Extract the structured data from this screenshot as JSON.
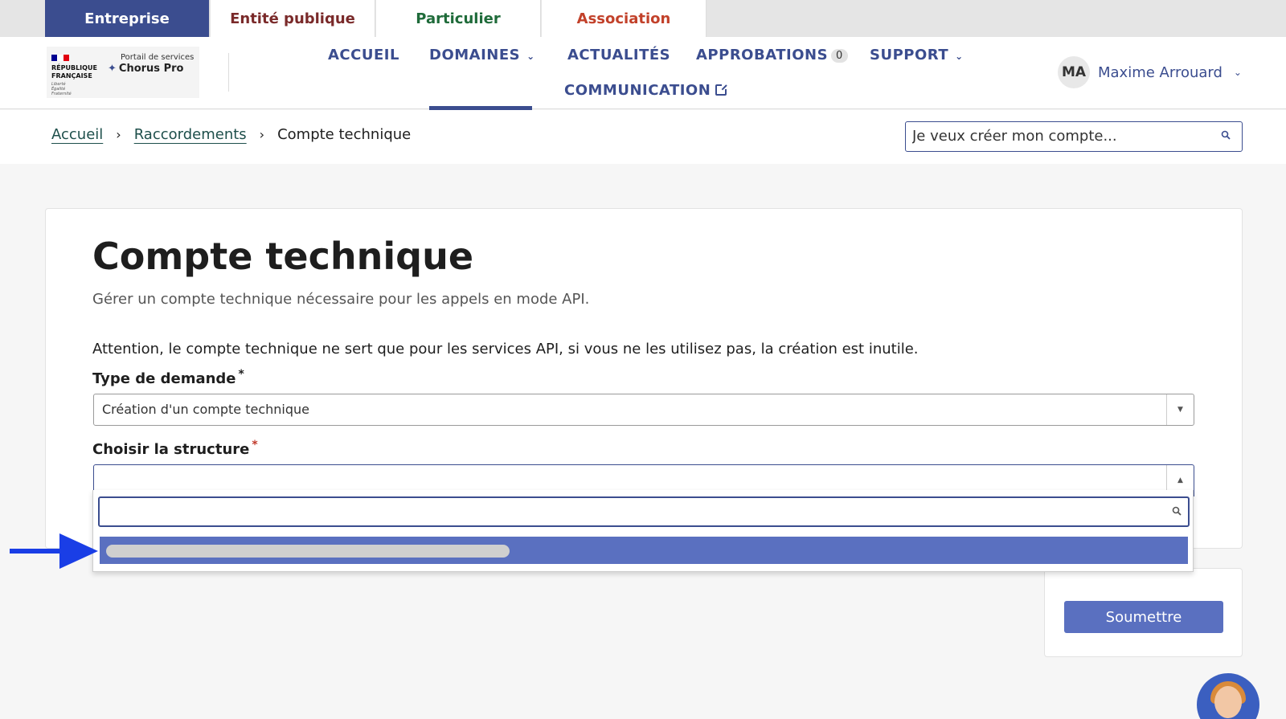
{
  "audience_tabs": [
    {
      "label": "Entreprise",
      "color": "#ffffff",
      "active": true
    },
    {
      "label": "Entité publique",
      "color": "#7a2a2a",
      "active": false
    },
    {
      "label": "Particulier",
      "color": "#1f6b3a",
      "active": false
    },
    {
      "label": "Association",
      "color": "#c2412a",
      "active": false
    }
  ],
  "logo": {
    "republique": "RÉPUBLIQUE FRANÇAISE",
    "devise": "Liberté Égalité Fraternité",
    "portail": "Portail de services",
    "product": "Chorus Pro"
  },
  "nav": {
    "accueil": "ACCUEIL",
    "domaines": "DOMAINES",
    "actualites": "ACTUALITÉS",
    "approbations": "APPROBATIONS",
    "approbations_count": "0",
    "support": "SUPPORT",
    "communication": "COMMUNICATION"
  },
  "user": {
    "initials": "MA",
    "name": "Maxime Arrouard"
  },
  "breadcrumb": {
    "home": "Accueil",
    "parent": "Raccordements",
    "current": "Compte technique",
    "separator": "›"
  },
  "search": {
    "placeholder": "Je veux créer mon compte..."
  },
  "form": {
    "title": "Compte technique",
    "subtitle": "Gérer un compte technique nécessaire pour les appels en mode API.",
    "warning": "Attention, le compte technique ne sert que pour les services API, si vous ne les utilisez pas, la création est inutile.",
    "type_label": "Type de demande",
    "type_value": "Création d'un compte technique",
    "structure_label": "Choisir la structure",
    "structure_value": "",
    "required_mark": "*"
  },
  "submit": {
    "label": "Soumettre"
  },
  "colors": {
    "primary": "#3b4d8f",
    "accent": "#5a70c0",
    "annotation_arrow": "#1a3ee6"
  }
}
